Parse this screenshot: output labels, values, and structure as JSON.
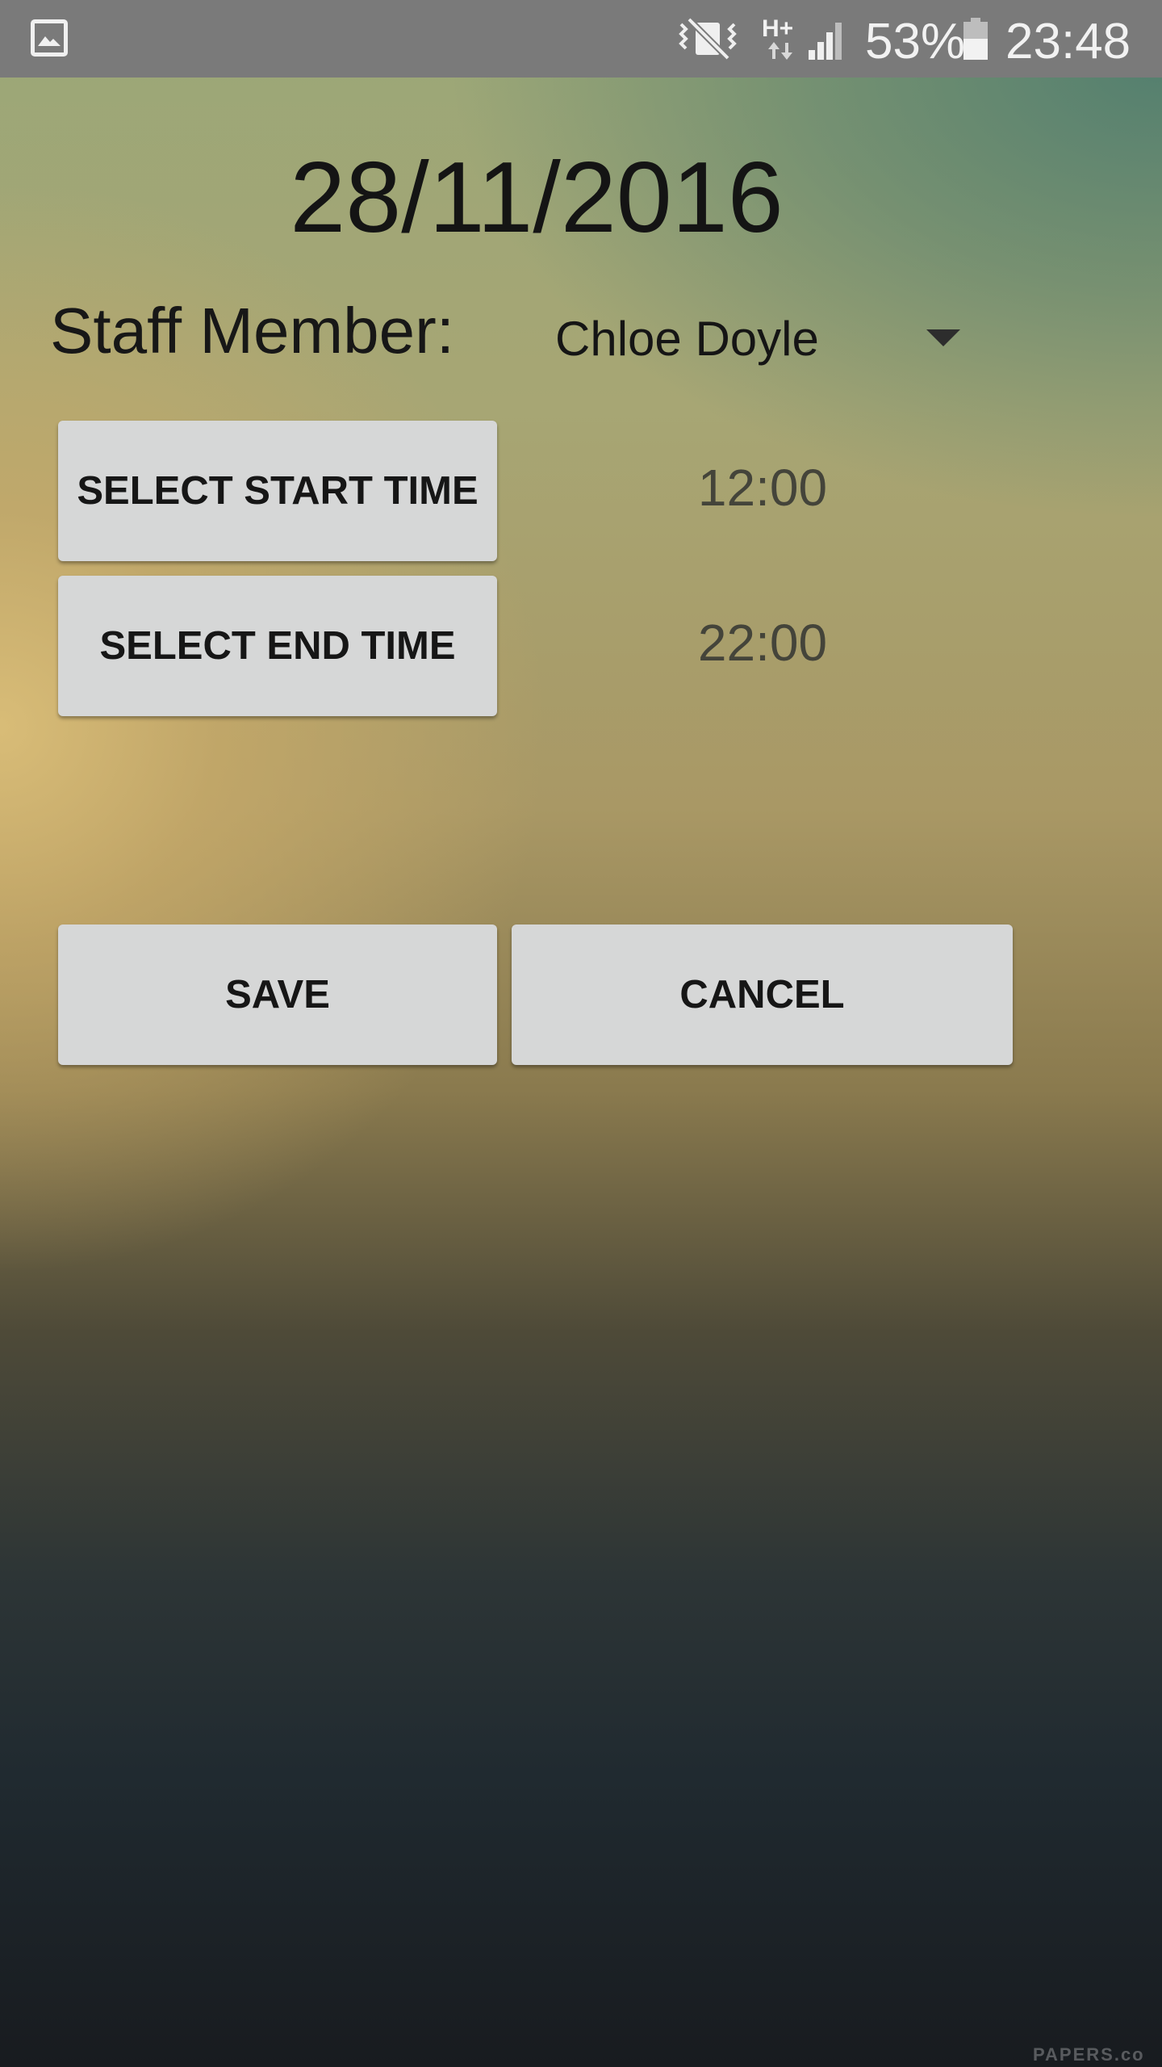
{
  "status_bar": {
    "notification_icon": "image-icon",
    "vibrate_icon": "vibrate-mute-icon",
    "network_type": "H+",
    "signal_icon": "cell-signal-icon",
    "battery_percent": "53%",
    "battery_icon": "battery-icon",
    "time": "23:48"
  },
  "form": {
    "date": "28/11/2016",
    "staff_label": "Staff Member:",
    "staff_selected": "Chloe Doyle",
    "start_button_label": "SELECT START TIME",
    "start_time": "12:00",
    "end_button_label": "SELECT END TIME",
    "end_time": "22:00",
    "save_label": "SAVE",
    "cancel_label": "CANCEL"
  },
  "background": {
    "watermark": "PAPERS.co"
  },
  "colors": {
    "status_bar": "#7a7a7a",
    "button_bg": "#d6d7d7",
    "text_dark": "#141414",
    "time_text": "#44443a"
  }
}
